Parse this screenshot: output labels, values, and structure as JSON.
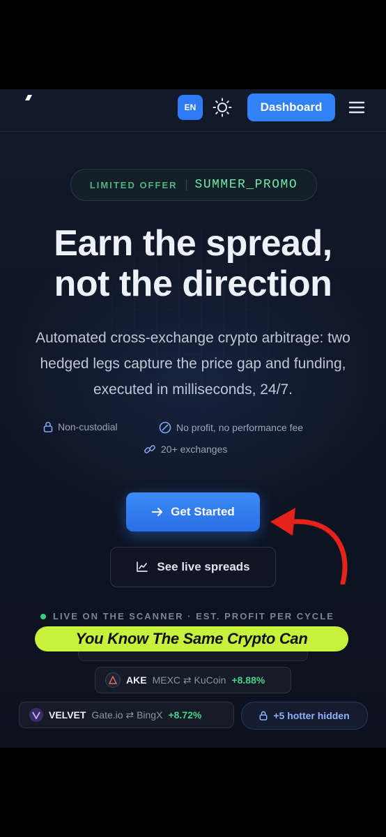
{
  "header": {
    "lang_label": "EN",
    "dashboard_label": "Dashboard",
    "theme_icon": "sun-icon",
    "menu_icon": "hamburger-menu-icon"
  },
  "promo": {
    "label": "LIMITED OFFER",
    "code": "SUMMER_PROMO"
  },
  "hero": {
    "headline_line1": "Earn the spread,",
    "headline_line2": "not the direction",
    "subline": "Automated cross-exchange crypto arbitrage: two hedged legs capture the price gap and funding, executed in milliseconds, 24/7."
  },
  "features": [
    {
      "icon": "lock-icon",
      "label": "Non-custodial"
    },
    {
      "icon": "no-fee-icon",
      "label": "No profit, no performance fee"
    },
    {
      "icon": "link-icon",
      "label": "20+ exchanges"
    }
  ],
  "cta": {
    "primary_label": "Get Started",
    "primary_icon": "arrow-right-icon",
    "secondary_label": "See live spreads",
    "secondary_icon": "chart-icon"
  },
  "scanner": {
    "label": "LIVE ON THE SCANNER · EST. PROFIT PER CYCLE",
    "pairs": [
      {
        "ticker": "AKE",
        "route": "MEXC ⇄ KuCoin",
        "gain": "+8.88%",
        "coin_color": "#1e2433"
      },
      {
        "ticker": "VELVET",
        "route": "Gate.io ⇄ BingX",
        "gain": "+8.72%",
        "coin_color": "#3b2a6a"
      }
    ],
    "hidden_label": "+5 hotter hidden"
  },
  "overlay_caption": "You Know The Same Crypto Can",
  "colors": {
    "accent": "#3182f6",
    "promo_green": "#6ee7a8",
    "gain_green": "#48d38a",
    "caption_bg": "#c6f23b",
    "annotation_red": "#e5231c"
  }
}
